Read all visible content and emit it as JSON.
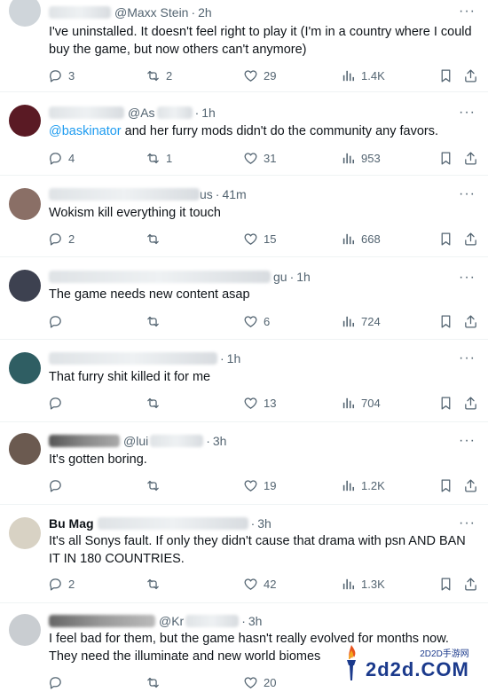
{
  "tweets": [
    {
      "handle": "@Maxx Stein",
      "time": "2h",
      "text": "I've uninstalled. It doesn't feel right to play it (I'm in a country where I could buy the game, but now others can't anymore)",
      "mention": "",
      "replies": "3",
      "retweets": "2",
      "likes": "29",
      "views": "1.4K",
      "avatar_color": "#cfd5da"
    },
    {
      "handle": "@As",
      "time": "1h",
      "mention": "@baskinator",
      "text": " and her furry mods didn't do the community any favors.",
      "replies": "4",
      "retweets": "1",
      "likes": "31",
      "views": "953",
      "avatar_color": "#5a1a24"
    },
    {
      "handle": "us",
      "time": "41m",
      "text": "Wokism kill everything it touch",
      "mention": "",
      "replies": "2",
      "retweets": "",
      "likes": "15",
      "views": "668",
      "avatar_color": "#8a6f66"
    },
    {
      "handle": "gu",
      "time": "1h",
      "text": "The game needs new content asap",
      "mention": "",
      "replies": "",
      "retweets": "",
      "likes": "6",
      "views": "724",
      "avatar_color": "#3d4150"
    },
    {
      "handle": "",
      "time": "1h",
      "text": "That furry shit killed it for me",
      "mention": "",
      "replies": "",
      "retweets": "",
      "likes": "13",
      "views": "704",
      "avatar_color": "#2f5e63"
    },
    {
      "handle": "@lui",
      "time": "3h",
      "text": "It's gotten boring.",
      "mention": "",
      "replies": "",
      "retweets": "",
      "likes": "19",
      "views": "1.2K",
      "avatar_color": "#6b5a50"
    },
    {
      "handle": "Bu Mag",
      "time": "3h",
      "text": "It's all Sonys fault. If only they didn't cause that drama with psn AND BAN IT IN 180 COUNTRIES.",
      "mention": "",
      "replies": "2",
      "retweets": "",
      "likes": "42",
      "views": "1.3K",
      "avatar_color": "#d8d2c4"
    },
    {
      "handle": "@Kr",
      "time": "3h",
      "text": "I feel bad for them, but the game hasn't really evolved for months now. They need the illuminate and new world biomes",
      "mention": "",
      "replies": "",
      "retweets": "",
      "likes": "20",
      "views": "",
      "avatar_color": "#c9cdd1"
    }
  ],
  "watermark": {
    "small": "2D2D手游网",
    "big": "2d2d.COM"
  }
}
